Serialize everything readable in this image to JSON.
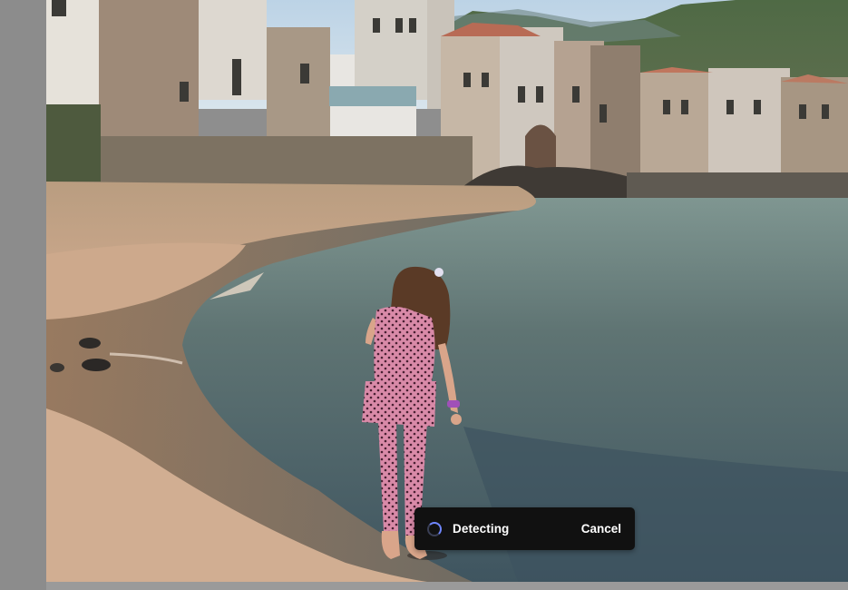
{
  "photo": {
    "subject": "girl-on-beach"
  },
  "toast": {
    "status_label": "Detecting",
    "cancel_label": "Cancel",
    "spinner_icon": "loading-spinner-icon",
    "background": "#111111",
    "spinner_color": "#6f86ff"
  }
}
